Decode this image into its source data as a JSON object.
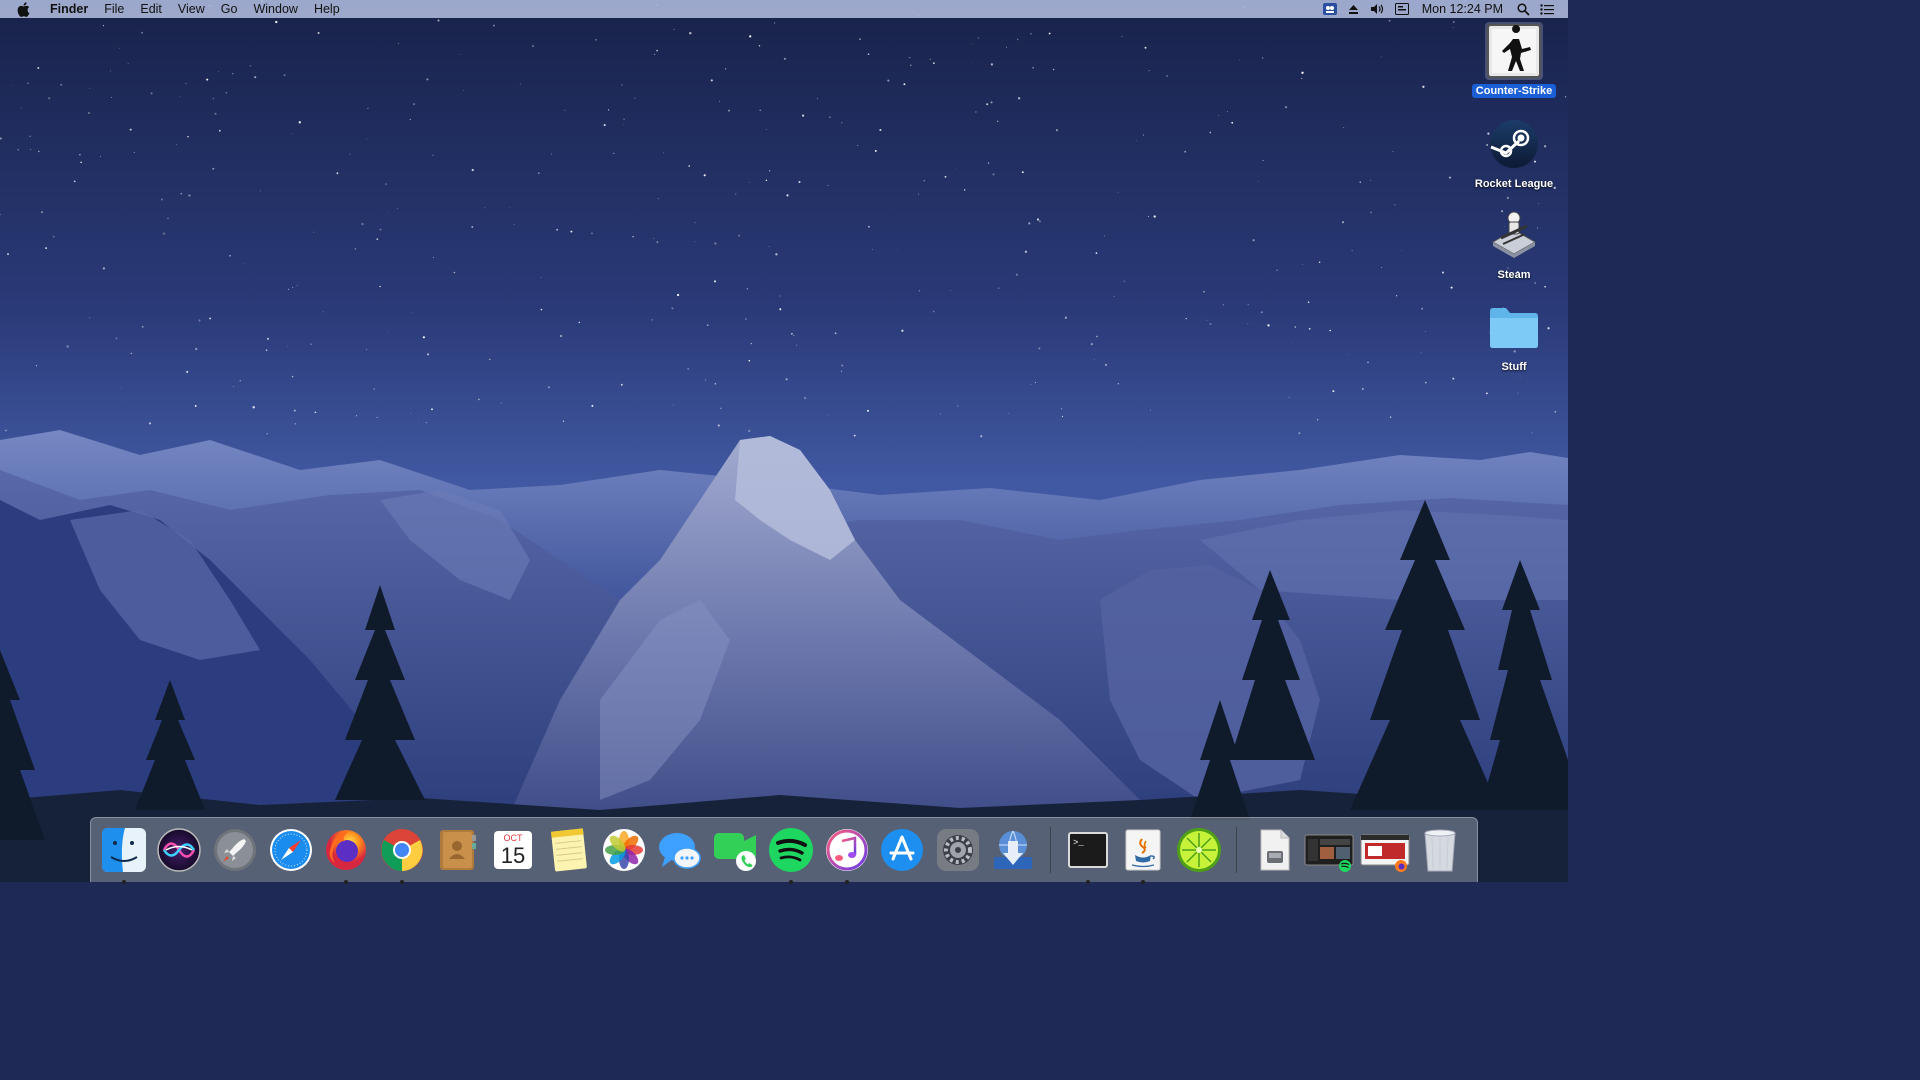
{
  "menubar": {
    "apple_icon": "apple-icon",
    "app_name": "Finder",
    "menus": [
      "File",
      "Edit",
      "View",
      "Go",
      "Window",
      "Help"
    ],
    "status_icons": [
      "vpn-icon",
      "eject-icon",
      "volume-icon",
      "input-source-icon"
    ],
    "clock": "Mon 12:24 PM",
    "spotlight_icon": "search-icon",
    "notification_icon": "list-icon"
  },
  "desktop": {
    "icons": [
      {
        "label": "Counter-Strike",
        "icon": "counter-strike-icon",
        "selected": true
      },
      {
        "label": "Rocket League",
        "icon": "steam-logo-icon",
        "selected": false
      },
      {
        "label": "Steam",
        "icon": "steam-installer-icon",
        "selected": false
      },
      {
        "label": "Stuff",
        "icon": "folder-icon",
        "selected": false
      }
    ]
  },
  "dock": {
    "apps": [
      {
        "name": "Finder",
        "icon": "finder-icon",
        "running": true
      },
      {
        "name": "Siri",
        "icon": "siri-icon",
        "running": false
      },
      {
        "name": "Launchpad",
        "icon": "rocket-icon",
        "running": false
      },
      {
        "name": "Safari",
        "icon": "compass-icon",
        "running": false
      },
      {
        "name": "Firefox",
        "icon": "firefox-icon",
        "running": true
      },
      {
        "name": "Chrome",
        "icon": "chrome-icon",
        "running": true
      },
      {
        "name": "Contacts",
        "icon": "contacts-icon",
        "running": false
      },
      {
        "name": "Calendar",
        "icon": "calendar-icon",
        "running": false,
        "month": "OCT",
        "day": "15"
      },
      {
        "name": "Notes",
        "icon": "notes-icon",
        "running": false
      },
      {
        "name": "Photos",
        "icon": "photos-icon",
        "running": false
      },
      {
        "name": "Messages",
        "icon": "messages-icon",
        "running": false
      },
      {
        "name": "FaceTime",
        "icon": "facetime-icon",
        "running": false
      },
      {
        "name": "Spotify",
        "icon": "spotify-icon",
        "running": true
      },
      {
        "name": "iTunes",
        "icon": "music-note-icon",
        "running": true
      },
      {
        "name": "App Store",
        "icon": "app-store-icon",
        "running": false
      },
      {
        "name": "System Preferences",
        "icon": "gear-icon",
        "running": false
      },
      {
        "name": "Downloader",
        "icon": "download-globe-icon",
        "running": false
      }
    ],
    "recent_apps": [
      {
        "name": "Terminal",
        "icon": "terminal-icon",
        "running": true,
        "prompt": ">_"
      },
      {
        "name": "Java",
        "icon": "java-icon",
        "running": true
      },
      {
        "name": "LimeWire",
        "icon": "lime-icon",
        "running": false
      }
    ],
    "stacks": [
      {
        "name": "Document",
        "icon": "document-stack-icon"
      },
      {
        "name": "Spotify Window",
        "icon": "window-thumbnail-icon"
      },
      {
        "name": "Firefox Window",
        "icon": "window-thumbnail-icon"
      },
      {
        "name": "Trash",
        "icon": "trash-icon"
      }
    ]
  }
}
